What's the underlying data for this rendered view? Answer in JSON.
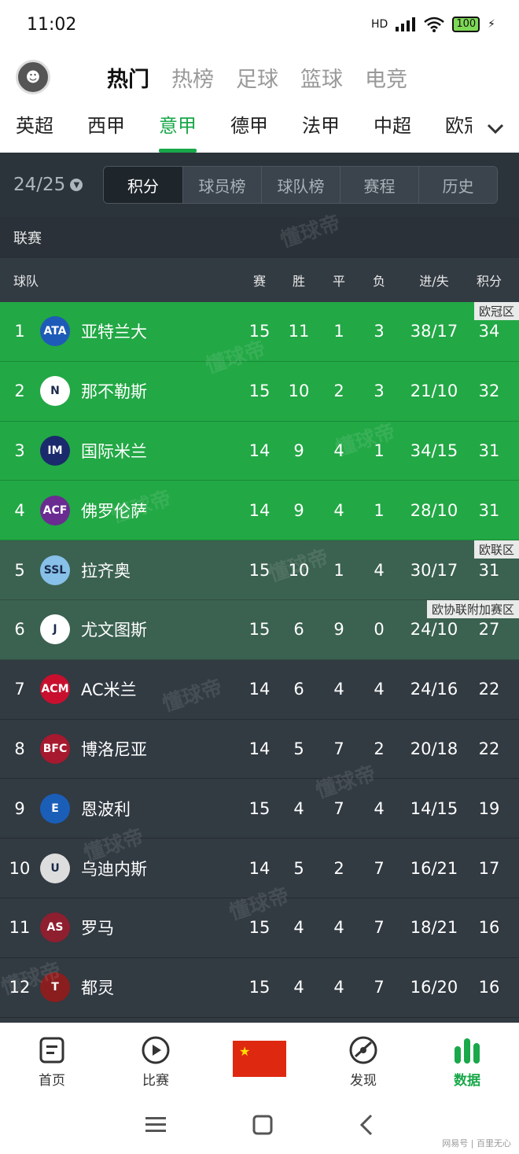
{
  "status": {
    "time": "11:02",
    "network": "HD",
    "battery": "100"
  },
  "topnav": {
    "tabs": [
      {
        "label": "热门",
        "active": true
      },
      {
        "label": "热榜",
        "active": false
      },
      {
        "label": "足球",
        "active": false
      },
      {
        "label": "篮球",
        "active": false
      },
      {
        "label": "电竞",
        "active": false
      }
    ]
  },
  "leagues": [
    {
      "label": "英超",
      "active": false
    },
    {
      "label": "西甲",
      "active": false
    },
    {
      "label": "意甲",
      "active": true
    },
    {
      "label": "德甲",
      "active": false
    },
    {
      "label": "法甲",
      "active": false
    },
    {
      "label": "中超",
      "active": false
    },
    {
      "label": "欧冠",
      "active": false
    }
  ],
  "season": "24/25",
  "segments": [
    {
      "label": "积分",
      "active": true
    },
    {
      "label": "球员榜",
      "active": false
    },
    {
      "label": "球队榜",
      "active": false
    },
    {
      "label": "赛程",
      "active": false
    },
    {
      "label": "历史",
      "active": false
    }
  ],
  "section_label": "联赛",
  "columns": {
    "team": "球队",
    "played": "赛",
    "won": "胜",
    "drawn": "平",
    "lost": "负",
    "goals": "进/失",
    "points": "积分"
  },
  "standings": [
    {
      "rank": "1",
      "team": "亚特兰大",
      "p": "15",
      "w": "11",
      "d": "1",
      "l": "3",
      "gd": "38/17",
      "pts": "34",
      "zone": "ucl",
      "zone_label": "欧冠区",
      "logo": "ATA",
      "logo_color": "#1e5bb8"
    },
    {
      "rank": "2",
      "team": "那不勒斯",
      "p": "15",
      "w": "10",
      "d": "2",
      "l": "3",
      "gd": "21/10",
      "pts": "32",
      "zone": "ucl",
      "zone_label": "",
      "logo": "N",
      "logo_color": "#ffffff"
    },
    {
      "rank": "3",
      "team": "国际米兰",
      "p": "14",
      "w": "9",
      "d": "4",
      "l": "1",
      "gd": "34/15",
      "pts": "31",
      "zone": "ucl",
      "zone_label": "",
      "logo": "IM",
      "logo_color": "#1a2a6c"
    },
    {
      "rank": "4",
      "team": "佛罗伦萨",
      "p": "14",
      "w": "9",
      "d": "4",
      "l": "1",
      "gd": "28/10",
      "pts": "31",
      "zone": "ucl",
      "zone_label": "",
      "logo": "ACF",
      "logo_color": "#6a2c91"
    },
    {
      "rank": "5",
      "team": "拉齐奥",
      "p": "15",
      "w": "10",
      "d": "1",
      "l": "4",
      "gd": "30/17",
      "pts": "31",
      "zone": "uel",
      "zone_label": "欧联区",
      "logo": "SSL",
      "logo_color": "#87c0e8"
    },
    {
      "rank": "6",
      "team": "尤文图斯",
      "p": "15",
      "w": "6",
      "d": "9",
      "l": "0",
      "gd": "24/10",
      "pts": "27",
      "zone": "uel",
      "zone_label": "欧协联附加赛区",
      "logo": "J",
      "logo_color": "#ffffff"
    },
    {
      "rank": "7",
      "team": "AC米兰",
      "p": "14",
      "w": "6",
      "d": "4",
      "l": "4",
      "gd": "24/16",
      "pts": "22",
      "zone": "normal",
      "zone_label": "",
      "logo": "ACM",
      "logo_color": "#c8102e"
    },
    {
      "rank": "8",
      "team": "博洛尼亚",
      "p": "14",
      "w": "5",
      "d": "7",
      "l": "2",
      "gd": "20/18",
      "pts": "22",
      "zone": "normal",
      "zone_label": "",
      "logo": "BFC",
      "logo_color": "#a6192e"
    },
    {
      "rank": "9",
      "team": "恩波利",
      "p": "15",
      "w": "4",
      "d": "7",
      "l": "4",
      "gd": "14/15",
      "pts": "19",
      "zone": "normal",
      "zone_label": "",
      "logo": "E",
      "logo_color": "#1a5eb8"
    },
    {
      "rank": "10",
      "team": "乌迪内斯",
      "p": "14",
      "w": "5",
      "d": "2",
      "l": "7",
      "gd": "16/21",
      "pts": "17",
      "zone": "normal",
      "zone_label": "",
      "logo": "U",
      "logo_color": "#dddddd"
    },
    {
      "rank": "11",
      "team": "罗马",
      "p": "15",
      "w": "4",
      "d": "4",
      "l": "7",
      "gd": "18/21",
      "pts": "16",
      "zone": "normal",
      "zone_label": "",
      "logo": "AS",
      "logo_color": "#8e1f2f"
    },
    {
      "rank": "12",
      "team": "都灵",
      "p": "15",
      "w": "4",
      "d": "4",
      "l": "7",
      "gd": "16/20",
      "pts": "16",
      "zone": "normal",
      "zone_label": "",
      "logo": "T",
      "logo_color": "#8a1e1e"
    }
  ],
  "bottomnav": [
    {
      "label": "首页",
      "icon": "home-icon",
      "active": false
    },
    {
      "label": "比赛",
      "icon": "play-icon",
      "active": false
    },
    {
      "label": "",
      "icon": "china-flag-icon",
      "active": false
    },
    {
      "label": "发现",
      "icon": "discover-icon",
      "active": false
    },
    {
      "label": "数据",
      "icon": "data-bars-icon",
      "active": true
    }
  ],
  "watermark": "懂球帝",
  "credit": "网易号 | 百里无心",
  "colors": {
    "accent": "#19a84a",
    "ucl": "#22a845",
    "uel": "#3b6150",
    "dark": "#323a42"
  }
}
